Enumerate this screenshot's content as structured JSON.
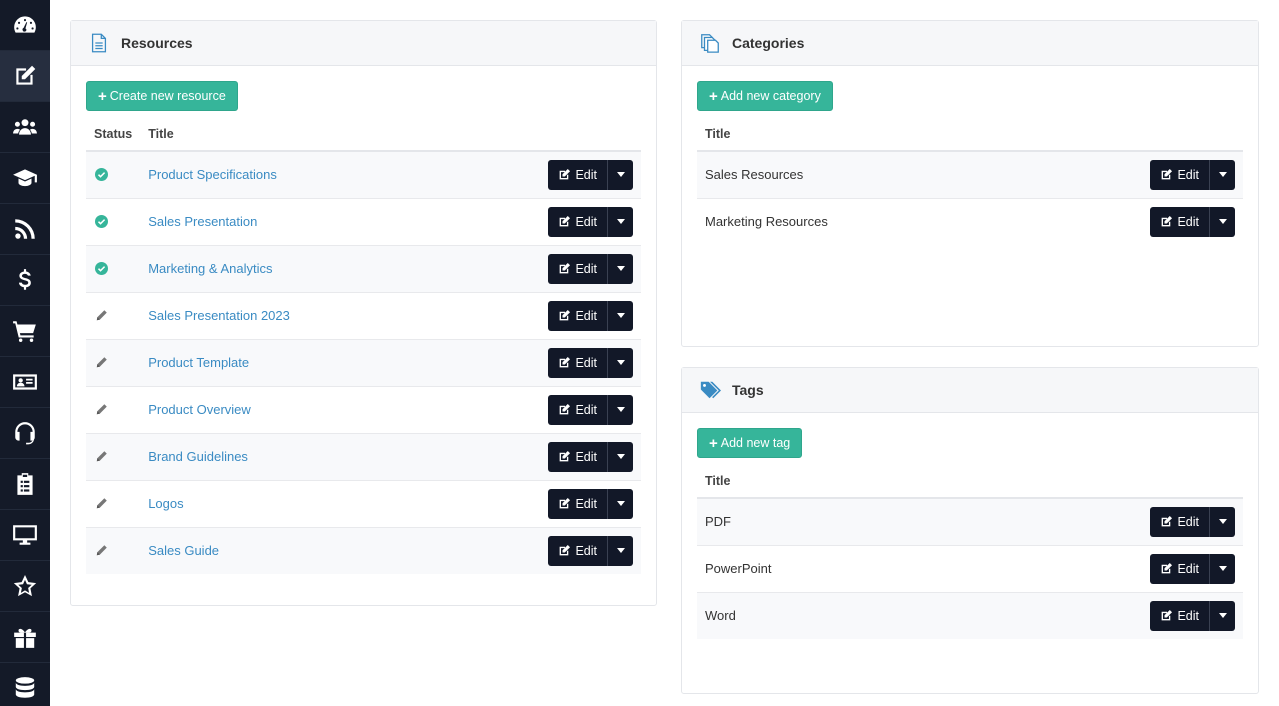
{
  "sidebar": {
    "items": [
      {
        "icon": "dashboard-icon"
      },
      {
        "icon": "edit-icon",
        "active": true
      },
      {
        "icon": "users-icon"
      },
      {
        "icon": "graduation-cap-icon"
      },
      {
        "icon": "rss-icon"
      },
      {
        "icon": "dollar-icon"
      },
      {
        "icon": "cart-icon"
      },
      {
        "icon": "id-card-icon"
      },
      {
        "icon": "headset-icon"
      },
      {
        "icon": "clipboard-icon"
      },
      {
        "icon": "monitor-icon"
      },
      {
        "icon": "star-icon"
      },
      {
        "icon": "gift-icon"
      },
      {
        "icon": "database-icon"
      }
    ]
  },
  "resources": {
    "title": "Resources",
    "create_label": "Create new resource",
    "col_status": "Status",
    "col_title": "Title",
    "edit_label": "Edit",
    "rows": [
      {
        "status": "published",
        "title": "Product Specifications"
      },
      {
        "status": "published",
        "title": "Sales Presentation"
      },
      {
        "status": "published",
        "title": "Marketing & Analytics"
      },
      {
        "status": "draft",
        "title": "Sales Presentation 2023"
      },
      {
        "status": "draft",
        "title": "Product Template"
      },
      {
        "status": "draft",
        "title": "Product Overview"
      },
      {
        "status": "draft",
        "title": "Brand Guidelines"
      },
      {
        "status": "draft",
        "title": "Logos"
      },
      {
        "status": "draft",
        "title": "Sales Guide"
      }
    ]
  },
  "categories": {
    "title": "Categories",
    "add_label": "Add new category",
    "col_title": "Title",
    "edit_label": "Edit",
    "rows": [
      {
        "title": "Sales Resources"
      },
      {
        "title": "Marketing Resources"
      }
    ]
  },
  "tags": {
    "title": "Tags",
    "add_label": "Add new tag",
    "col_title": "Title",
    "edit_label": "Edit",
    "rows": [
      {
        "title": "PDF"
      },
      {
        "title": "PowerPoint"
      },
      {
        "title": "Word"
      }
    ]
  },
  "colors": {
    "sidebar_bg": "#141a28",
    "accent_green": "#36b59a",
    "link_blue": "#3a8bc3",
    "button_dark": "#121828"
  }
}
